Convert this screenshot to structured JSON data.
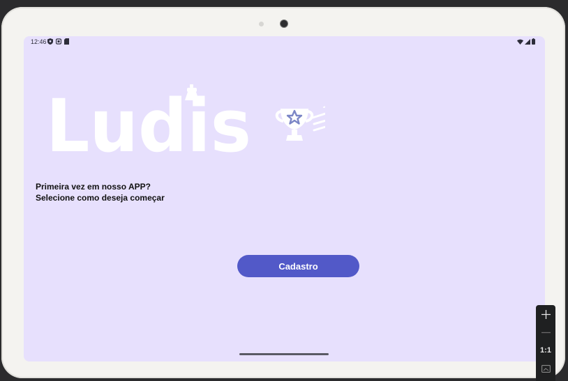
{
  "status_bar": {
    "time": "12:46",
    "left_icons": [
      "shield-icon",
      "notification-icon",
      "sd-card-icon"
    ],
    "right_icons": [
      "wifi-icon",
      "signal-icon",
      "battery-icon"
    ]
  },
  "logo": {
    "text": "Ludis",
    "emblem": "trophy-star-icon"
  },
  "intro": {
    "line1": "Primeira vez em nosso APP?",
    "line2": "Selecione como deseja começar"
  },
  "actions": {
    "signup_label": "Cadastro"
  },
  "zoom_panel": {
    "items": [
      "plus-icon",
      "minus-icon",
      "1:1",
      "fit-screen-icon"
    ],
    "one_to_one_label": "1:1"
  },
  "colors": {
    "screen_bg": "#e7e0fd",
    "primary_button": "#5259c8",
    "logo_accent": "#7b86c6"
  }
}
